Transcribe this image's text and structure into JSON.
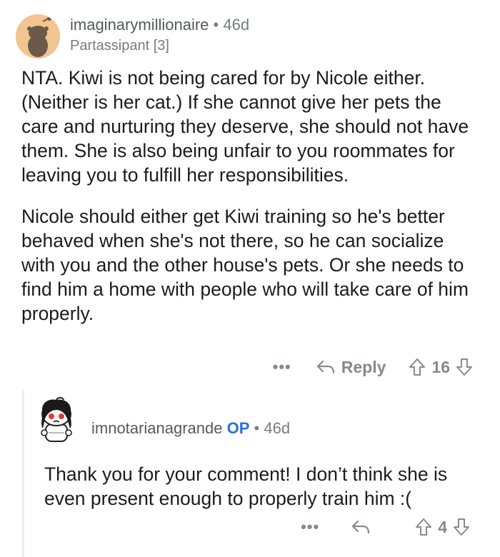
{
  "comment1": {
    "username": "imaginarymillionaire",
    "separator": "•",
    "age": "46d",
    "flair": "Partassipant [3]",
    "paragraphs": [
      "NTA. Kiwi is not being cared for by Nicole either. (Neither is her cat.) If she cannot give her pets the care and nurturing they deserve, she should not have them. She is also being unfair to you roommates for leaving you to fulfill her responsibilities.",
      "Nicole should either get Kiwi training so he's better behaved when she's not there, so he can socialize with you and the other house's pets. Or she needs to find him a home with people who will take care of him properly."
    ],
    "more_label": "•••",
    "reply_label": "Reply",
    "vote_count": "16"
  },
  "comment2": {
    "username": "imnotarianagrande",
    "op_badge": "OP",
    "separator": "•",
    "age": "46d",
    "body": "Thank you for your comment! I don’t think she is even present enough to properly train him :(",
    "more_label": "•••",
    "vote_count": "4"
  }
}
